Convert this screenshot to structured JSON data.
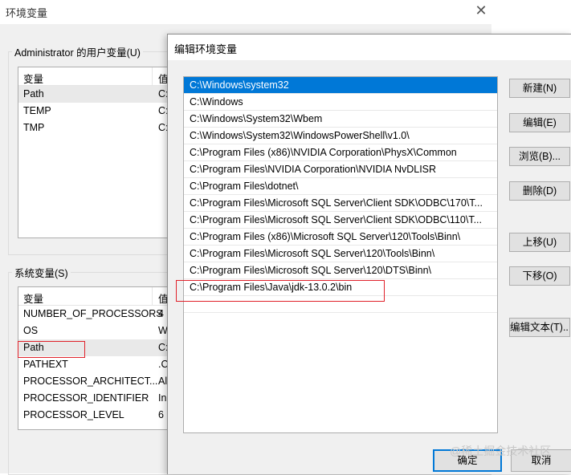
{
  "back_window": {
    "title": "环境变量",
    "close_icon": "close-icon",
    "user_vars": {
      "legend": "Administrator 的用户变量(U)",
      "col_name": "变量",
      "col_value": "值",
      "rows": [
        {
          "name": "Path",
          "value": "C:"
        },
        {
          "name": "TEMP",
          "value": "C:"
        },
        {
          "name": "TMP",
          "value": "C:"
        }
      ]
    },
    "system_vars": {
      "legend": "系统变量(S)",
      "col_name": "变量",
      "col_value": "值",
      "rows": [
        {
          "name": "NUMBER_OF_PROCESSORS",
          "value": "4"
        },
        {
          "name": "OS",
          "value": "W"
        },
        {
          "name": "Path",
          "value": "C:"
        },
        {
          "name": "PATHEXT",
          "value": ".C"
        },
        {
          "name": "PROCESSOR_ARCHITECT...",
          "value": "Al"
        },
        {
          "name": "PROCESSOR_IDENTIFIER",
          "value": "In"
        },
        {
          "name": "PROCESSOR_LEVEL",
          "value": "6"
        }
      ]
    }
  },
  "dialog": {
    "title": "编辑环境变量",
    "paths": [
      "C:\\Windows\\system32",
      "C:\\Windows",
      "C:\\Windows\\System32\\Wbem",
      "C:\\Windows\\System32\\WindowsPowerShell\\v1.0\\",
      "C:\\Program Files (x86)\\NVIDIA Corporation\\PhysX\\Common",
      "C:\\Program Files\\NVIDIA Corporation\\NVIDIA NvDLISR",
      "C:\\Program Files\\dotnet\\",
      "C:\\Program Files\\Microsoft SQL Server\\Client SDK\\ODBC\\170\\T...",
      "C:\\Program Files\\Microsoft SQL Server\\Client SDK\\ODBC\\110\\T...",
      "C:\\Program Files (x86)\\Microsoft SQL Server\\120\\Tools\\Binn\\",
      "C:\\Program Files\\Microsoft SQL Server\\120\\Tools\\Binn\\",
      "C:\\Program Files\\Microsoft SQL Server\\120\\DTS\\Binn\\",
      "C:\\Program Files\\Java\\jdk-13.0.2\\bin"
    ],
    "buttons": {
      "new": "新建(N)",
      "edit": "编辑(E)",
      "browse": "浏览(B)...",
      "delete": "删除(D)",
      "move_up": "上移(U)",
      "move_down": "下移(O)",
      "edit_text": "编辑文本(T)...",
      "ok": "确定",
      "cancel": "取消"
    }
  },
  "watermark": "@稀土掘金技术社区",
  "colors": {
    "selection": "#0078d7",
    "highlight_box": "#e0212a"
  }
}
